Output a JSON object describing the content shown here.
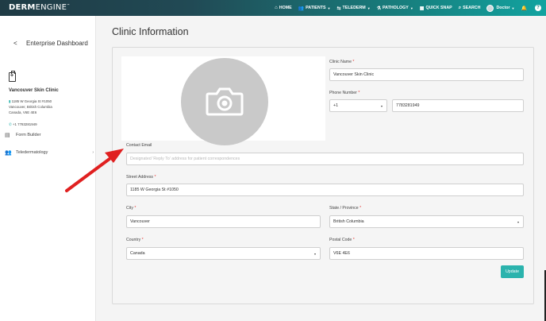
{
  "brand": {
    "bold": "DERM",
    "light": "ENGINE",
    "tm": "™"
  },
  "nav": {
    "home": "HOME",
    "patients": "PATIENTS",
    "telederm": "TELEDERM",
    "pathology": "PATHOLOGY",
    "quick_snap": "QUICK SNAP",
    "search": "SEARCH",
    "user": "Doctor"
  },
  "sidebar": {
    "back": "<",
    "title": "Enterprise Dashboard",
    "clinic_name": "Vancouver Skin Clinic",
    "address_lines": [
      "1185 W Georgia St #1050",
      "Vancouver, British Columbia",
      "Canada, V6E 4E6"
    ],
    "phone": "+1 7783281949",
    "items": [
      {
        "label": "Form Builder"
      },
      {
        "label": "Teledermatology"
      }
    ]
  },
  "main": {
    "title": "Clinic Information",
    "form": {
      "clinic_name_label": "Clinic Name",
      "clinic_name_value": "Vancouver Skin Clinic",
      "phone_label": "Phone Number",
      "phone_code": "+1",
      "phone_value": "7783281949",
      "contact_email_label": "Contact Email",
      "contact_email_placeholder": "Designated 'Reply To' address for patient correspondences",
      "street_label": "Street Address",
      "street_value": "1185 W Georgia St #1050",
      "city_label": "City",
      "city_value": "Vancouver",
      "state_label": "State / Province",
      "state_value": "British Columbia",
      "country_label": "Country",
      "country_value": "Canada",
      "postal_label": "Postal Code",
      "postal_value": "V6E 4E6",
      "required_mark": "*",
      "update_button": "Update"
    }
  },
  "colors": {
    "accent": "#2bb3ad",
    "nav_dark": "#1f3b45",
    "arrow": "#e02020"
  }
}
